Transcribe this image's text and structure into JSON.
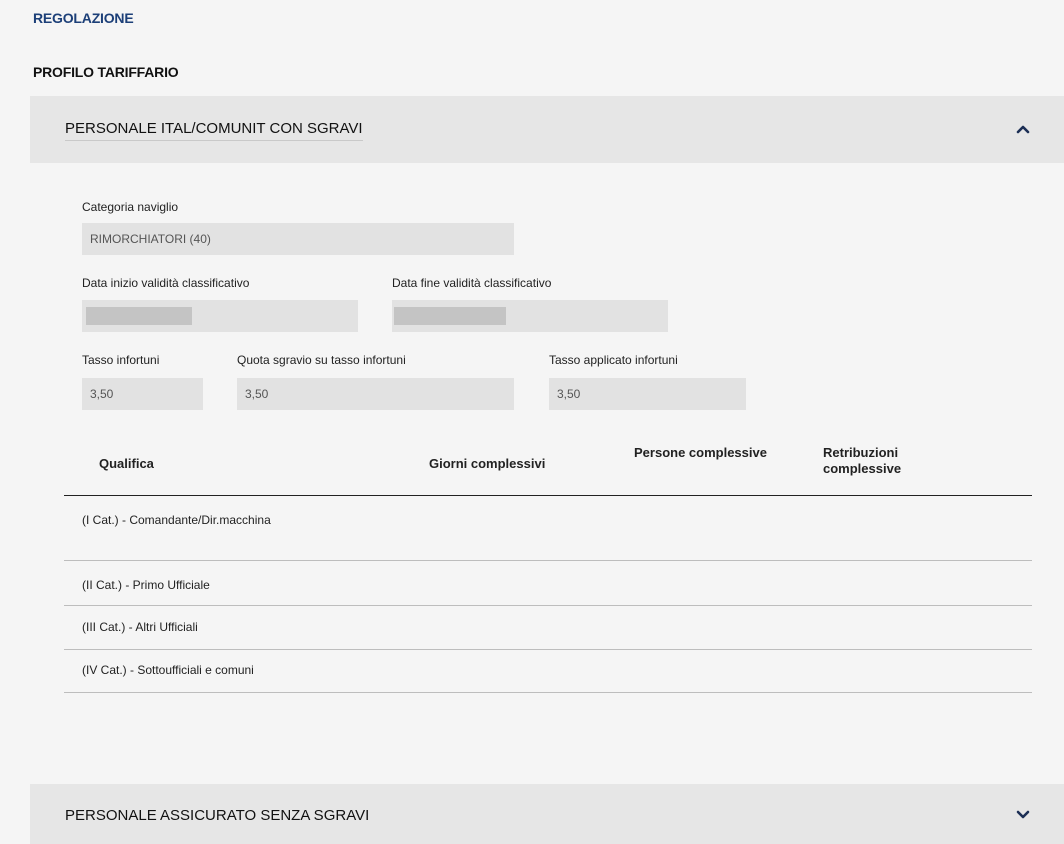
{
  "breadcrumb": {
    "section_label": "REGOLAZIONE"
  },
  "profile": {
    "title": "PROFILO TARIFFARIO"
  },
  "accordions": [
    {
      "title": "PERSONALE ITAL/COMUNIT CON SGRAVI",
      "expanded": true,
      "toggle_icon": "chevron-up-icon"
    },
    {
      "title": "PERSONALE ASSICURATO SENZA SGRAVI",
      "expanded": false,
      "toggle_icon": "chevron-down-icon"
    }
  ],
  "form": {
    "categoria_label": "Categoria naviglio",
    "categoria_value": "RIMORCHIATORI (40)",
    "data_inizio_label": "Data inizio validità classificativo",
    "data_fine_label": "Data fine validità classificativo",
    "tasso_infortuni_label": "Tasso infortuni",
    "tasso_infortuni_value": "3,50",
    "quota_sgravio_label": "Quota sgravio su tasso infortuni",
    "quota_sgravio_value": "3,50",
    "tasso_applicato_label": "Tasso applicato infortuni",
    "tasso_applicato_value": "3,50"
  },
  "table": {
    "headers": [
      "Qualifica",
      "Giorni complessivi",
      "Persone complessive",
      "Retribuzioni complessive"
    ],
    "rows": [
      {
        "qualifica": "(I Cat.) - Comandante/Dir.macchina"
      },
      {
        "qualifica": "(II Cat.) - Primo Ufficiale"
      },
      {
        "qualifica": "(III Cat.) - Altri Ufficiali"
      },
      {
        "qualifica": "(IV Cat.) - Sottoufficiali e comuni"
      }
    ]
  },
  "colors": {
    "link": "#1c3f78",
    "accordion_bg": "#e6e6e6",
    "field_bg": "#e2e2e2",
    "page_bg": "#f5f5f5"
  }
}
